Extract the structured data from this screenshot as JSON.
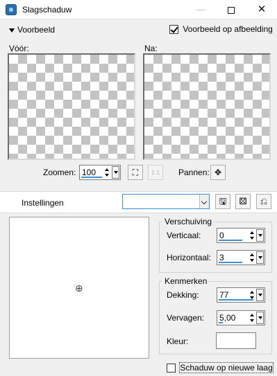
{
  "window": {
    "title": "Slagschaduw"
  },
  "preview_section": {
    "toggle_label": "Voorbeeld",
    "on_image_label": "Voorbeeld op afbeelding",
    "on_image_checked": true,
    "before_label": "Vóór:",
    "after_label": "Na:",
    "zoom_label": "Zoomen:",
    "zoom_value": "100",
    "pan_label": "Pannen:"
  },
  "settings": {
    "label": "Instellingen",
    "preset_value": ""
  },
  "offset": {
    "group_title": "Verschuiving",
    "vertical_label": "Verticaal:",
    "vertical_value": "0",
    "horizontal_label": "Horizontaal:",
    "horizontal_value": "3"
  },
  "properties": {
    "group_title": "Kenmerken",
    "opacity_label": "Dekking:",
    "opacity_value": "77",
    "blur_label": "Vervagen:",
    "blur_value": "5,00",
    "color_label": "Kleur:",
    "color_value": "#ffffff"
  },
  "new_layer": {
    "label": "Schaduw op nieuwe laag",
    "checked": false
  },
  "colors": {
    "accent": "#3a8fd8"
  }
}
